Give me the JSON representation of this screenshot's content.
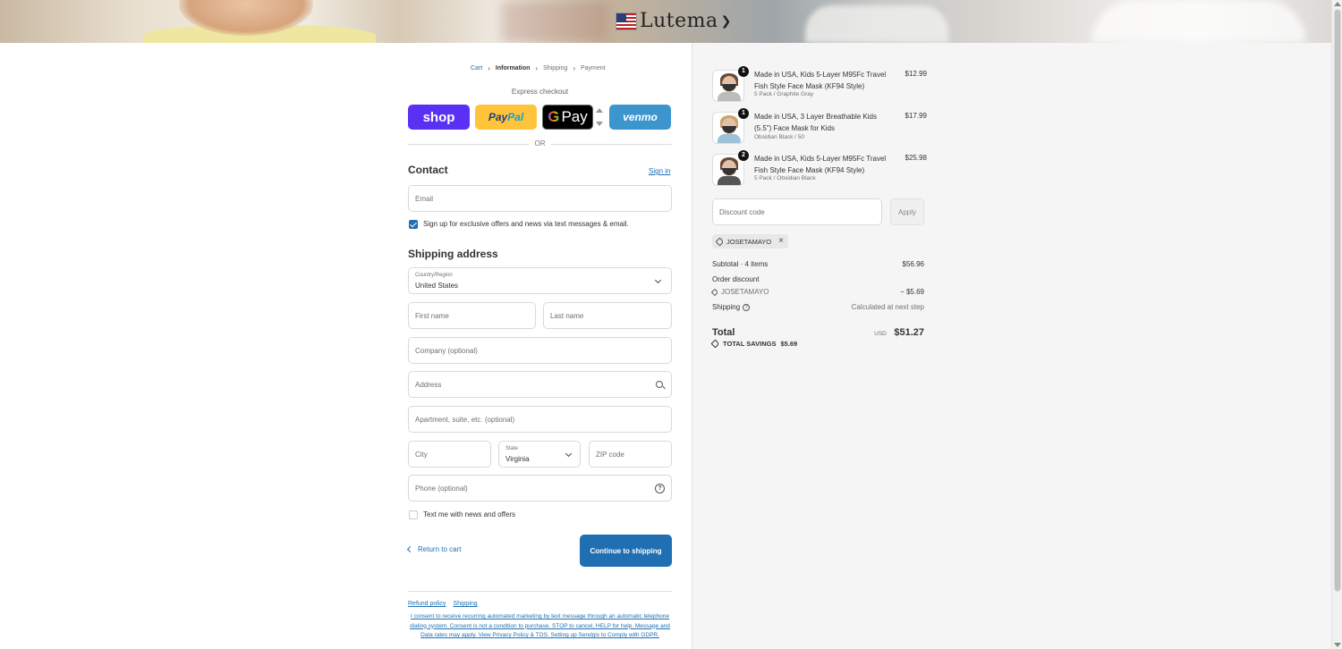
{
  "header": {
    "logo_text": "Lutema",
    "flag_icon": "us-flag-icon"
  },
  "breadcrumb": {
    "items": [
      "Cart",
      "Information",
      "Shipping",
      "Payment"
    ],
    "current": "Information"
  },
  "express_checkout": {
    "label": "Express checkout",
    "buttons": {
      "shop": "shop",
      "paypal_pay": "Pay",
      "paypal_pal": "Pal",
      "gpay_g": "G",
      "gpay_pay": "Pay",
      "venmo": "venmo"
    },
    "or_text": "OR"
  },
  "contact": {
    "title": "Contact",
    "sign_in": "Sign in",
    "email_placeholder": "Email",
    "marketing_checkbox_label": "Sign up for exclusive offers and news via text messages & email.",
    "marketing_checked": true
  },
  "shipping_address": {
    "title": "Shipping address",
    "country_label": "Country/Region",
    "country_value": "United States",
    "first_name_placeholder": "First name",
    "last_name_placeholder": "Last name",
    "company_placeholder": "Company (optional)",
    "address_placeholder": "Address",
    "apartment_placeholder": "Apartment, suite, etc. (optional)",
    "city_placeholder": "City",
    "state_label": "State",
    "state_value": "Virginia",
    "zip_placeholder": "ZIP code",
    "phone_placeholder": "Phone (optional)",
    "text_me_label": "Text me with news and offers",
    "text_me_checked": false
  },
  "actions": {
    "return_label": "Return to cart",
    "continue_label": "Continue to shipping"
  },
  "footer": {
    "links": [
      "Refund policy",
      "Shipping"
    ],
    "consent_text": "I consent to receive recurring automated marketing by text message through an automatic telephone dialing system. Consent is not a condition to purchase. STOP to cancel, HELP for help. Message and Data rates may apply. View Privacy Policy & TOS. Setting up Sendgix to Comply with GDPR."
  },
  "order": {
    "items": [
      {
        "qty": "1",
        "title": "Made in USA, Kids 5-Layer M95Fc Travel Fish Style Face Mask (KF94 Style)",
        "variant": "5 Pack / Graphite Gray",
        "price": "$12.99"
      },
      {
        "qty": "1",
        "title": "Made in USA, 3 Layer Breathable Kids (5.5\") Face Mask for Kids",
        "variant": "Obsidian Black / 50",
        "price": "$17.99"
      },
      {
        "qty": "2",
        "title": "Made in USA, Kids 5-Layer M95Fc Travel Fish Style Face Mask (KF94 Style)",
        "variant": "5 Pack / Obsidian Black",
        "price": "$25.98"
      }
    ],
    "discount_placeholder": "Discount code",
    "apply_label": "Apply",
    "applied_code": "JOSETAMAYO",
    "subtotal_label": "Subtotal · 4 items",
    "subtotal_value": "$56.96",
    "order_discount_label": "Order discount",
    "discount_code": "JOSETAMAYO",
    "discount_value": "− $5.69",
    "shipping_label": "Shipping",
    "shipping_value": "Calculated at next step",
    "total_label": "Total",
    "currency": "USD",
    "total_value": "$51.27",
    "savings_label": "TOTAL SAVINGS",
    "savings_value": "$5.69"
  },
  "colors": {
    "accent": "#1f6fb2",
    "shop_pay": "#5a31f4",
    "paypal": "#ffc439",
    "venmo": "#3d95ce"
  }
}
